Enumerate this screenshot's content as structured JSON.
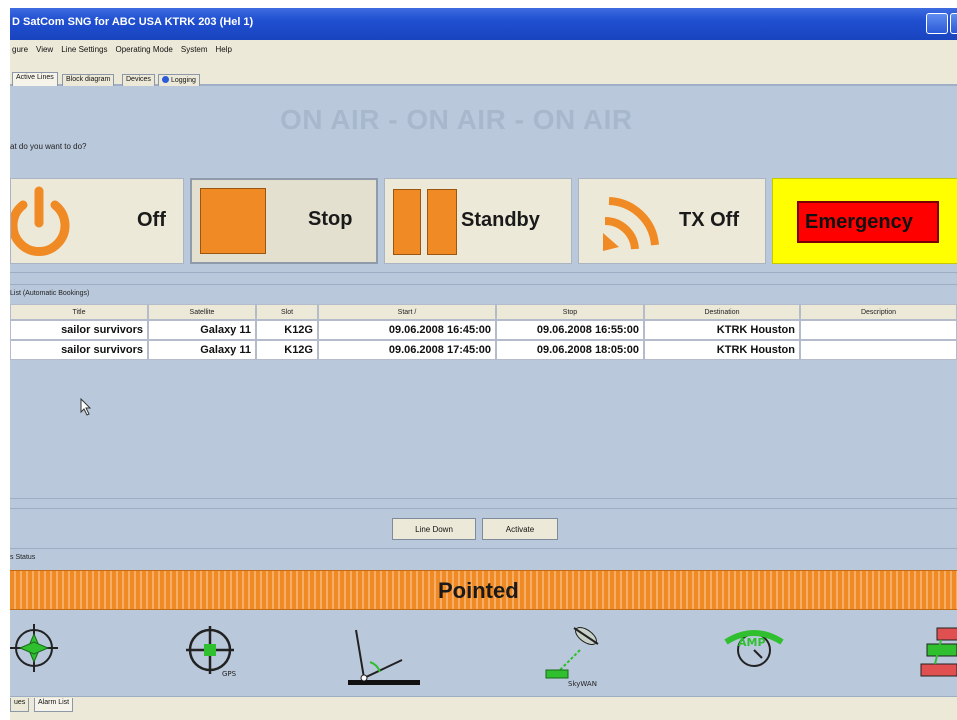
{
  "window": {
    "title": "D SatCom SNG for ABC USA KTRK 203 (Hel 1)"
  },
  "menubar": [
    "gure",
    "View",
    "Line Settings",
    "Operating Mode",
    "System",
    "Help"
  ],
  "tabs": [
    {
      "label": "Active Lines"
    },
    {
      "label": "Block diagram"
    },
    {
      "label": "Devices"
    },
    {
      "label": "Logging"
    }
  ],
  "banner": "ON AIR - ON AIR - ON AIR",
  "prompt": "at do you want to do?",
  "actions": {
    "off": "Off",
    "stop": "Stop",
    "standby": "Standby",
    "tx_off": "TX Off",
    "emergency": "Emergency"
  },
  "colors": {
    "accent_orange": "#f08a24",
    "emergency_bg": "#ffff00",
    "emergency_box": "#ff0000",
    "panel_bg": "#b9c8db"
  },
  "line_list": {
    "title": "List (Automatic Bookings)",
    "columns": [
      "Title",
      "Satellite",
      "Slot",
      "Start /",
      "Stop",
      "Destination",
      "Description"
    ],
    "rows": [
      [
        "sailor survivors",
        "Galaxy 11",
        "K12G",
        "09.06.2008 16:45:00",
        "09.06.2008 16:55:00",
        "KTRK Houston",
        ""
      ],
      [
        "sailor survivors",
        "Galaxy 11",
        "K12G",
        "09.06.2008 17:45:00",
        "09.06.2008 18:05:00",
        "KTRK Houston",
        ""
      ]
    ]
  },
  "buttons": {
    "line_down": "Line Down",
    "activate": "Activate"
  },
  "status": {
    "label": "s Status",
    "state": "Pointed"
  },
  "status_icons": [
    "compass-icon",
    "gps-crosshair-icon",
    "elevation-angle-icon",
    "satellite-skywan-icon",
    "amp-icon",
    "modem-icon"
  ],
  "status_icon_labels": {
    "gps": "GPS",
    "skywan": "SkyWAN",
    "amp": "AMP"
  },
  "bottom_tabs": [
    "ues",
    "Alarm List"
  ]
}
